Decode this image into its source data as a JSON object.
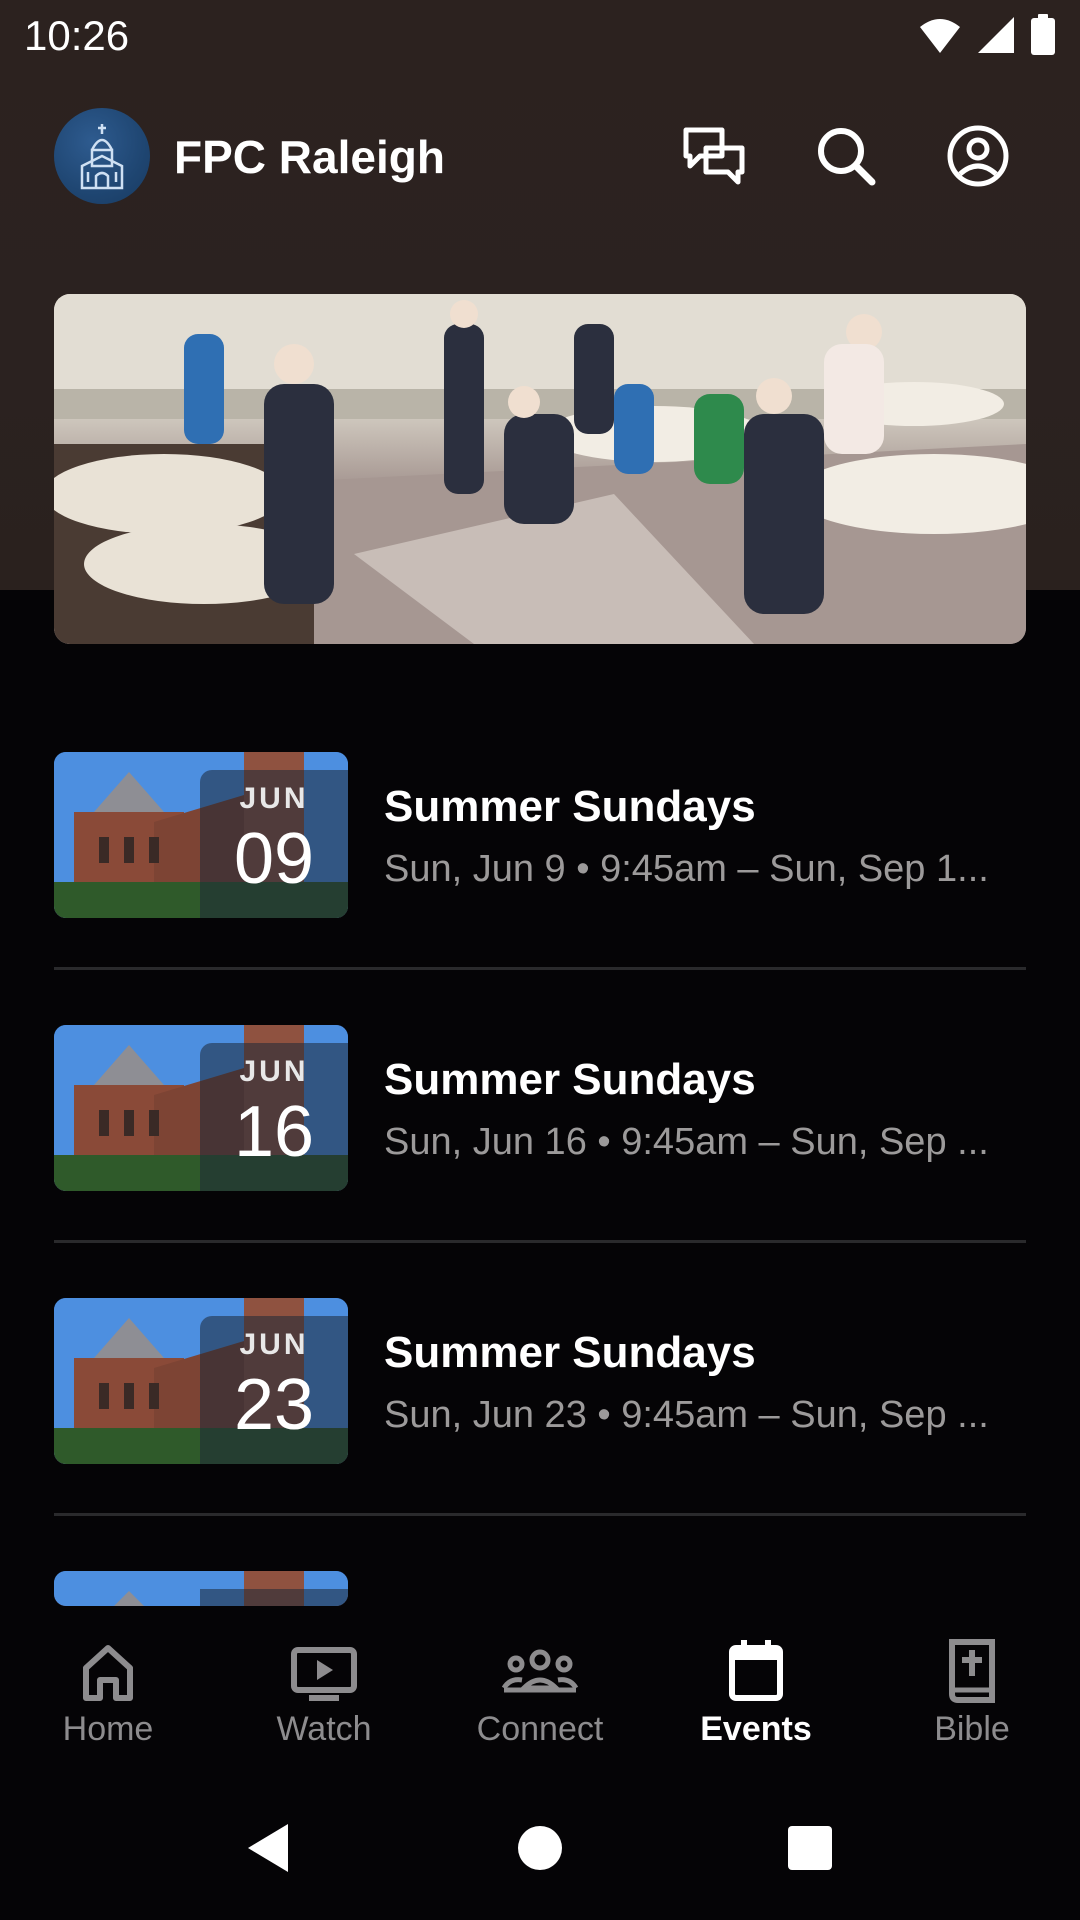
{
  "status_bar": {
    "time": "10:26"
  },
  "app": {
    "title": "FPC Raleigh"
  },
  "top_actions": {
    "chat_icon": "chat-bubbles-icon",
    "search_icon": "search-icon",
    "profile_icon": "account-circle-icon"
  },
  "events": [
    {
      "month": "JUN",
      "day": "09",
      "title": "Summer Sundays",
      "subtitle": "Sun, Jun 9 • 9:45am – Sun, Sep 1..."
    },
    {
      "month": "JUN",
      "day": "16",
      "title": "Summer Sundays",
      "subtitle": "Sun, Jun 16 • 9:45am – Sun, Sep ..."
    },
    {
      "month": "JUN",
      "day": "23",
      "title": "Summer Sundays",
      "subtitle": "Sun, Jun 23 • 9:45am – Sun, Sep ..."
    }
  ],
  "bottom_nav": {
    "items": [
      {
        "label": "Home",
        "icon": "home-icon"
      },
      {
        "label": "Watch",
        "icon": "tv-play-icon"
      },
      {
        "label": "Connect",
        "icon": "group-icon"
      },
      {
        "label": "Events",
        "icon": "calendar-icon",
        "active": true
      },
      {
        "label": "Bible",
        "icon": "bible-icon"
      }
    ]
  },
  "colors": {
    "header_bg": "#2b2220",
    "page_bg": "#050406",
    "inactive_nav": "#8d8c8e",
    "subtitle": "#9c9a9a"
  }
}
